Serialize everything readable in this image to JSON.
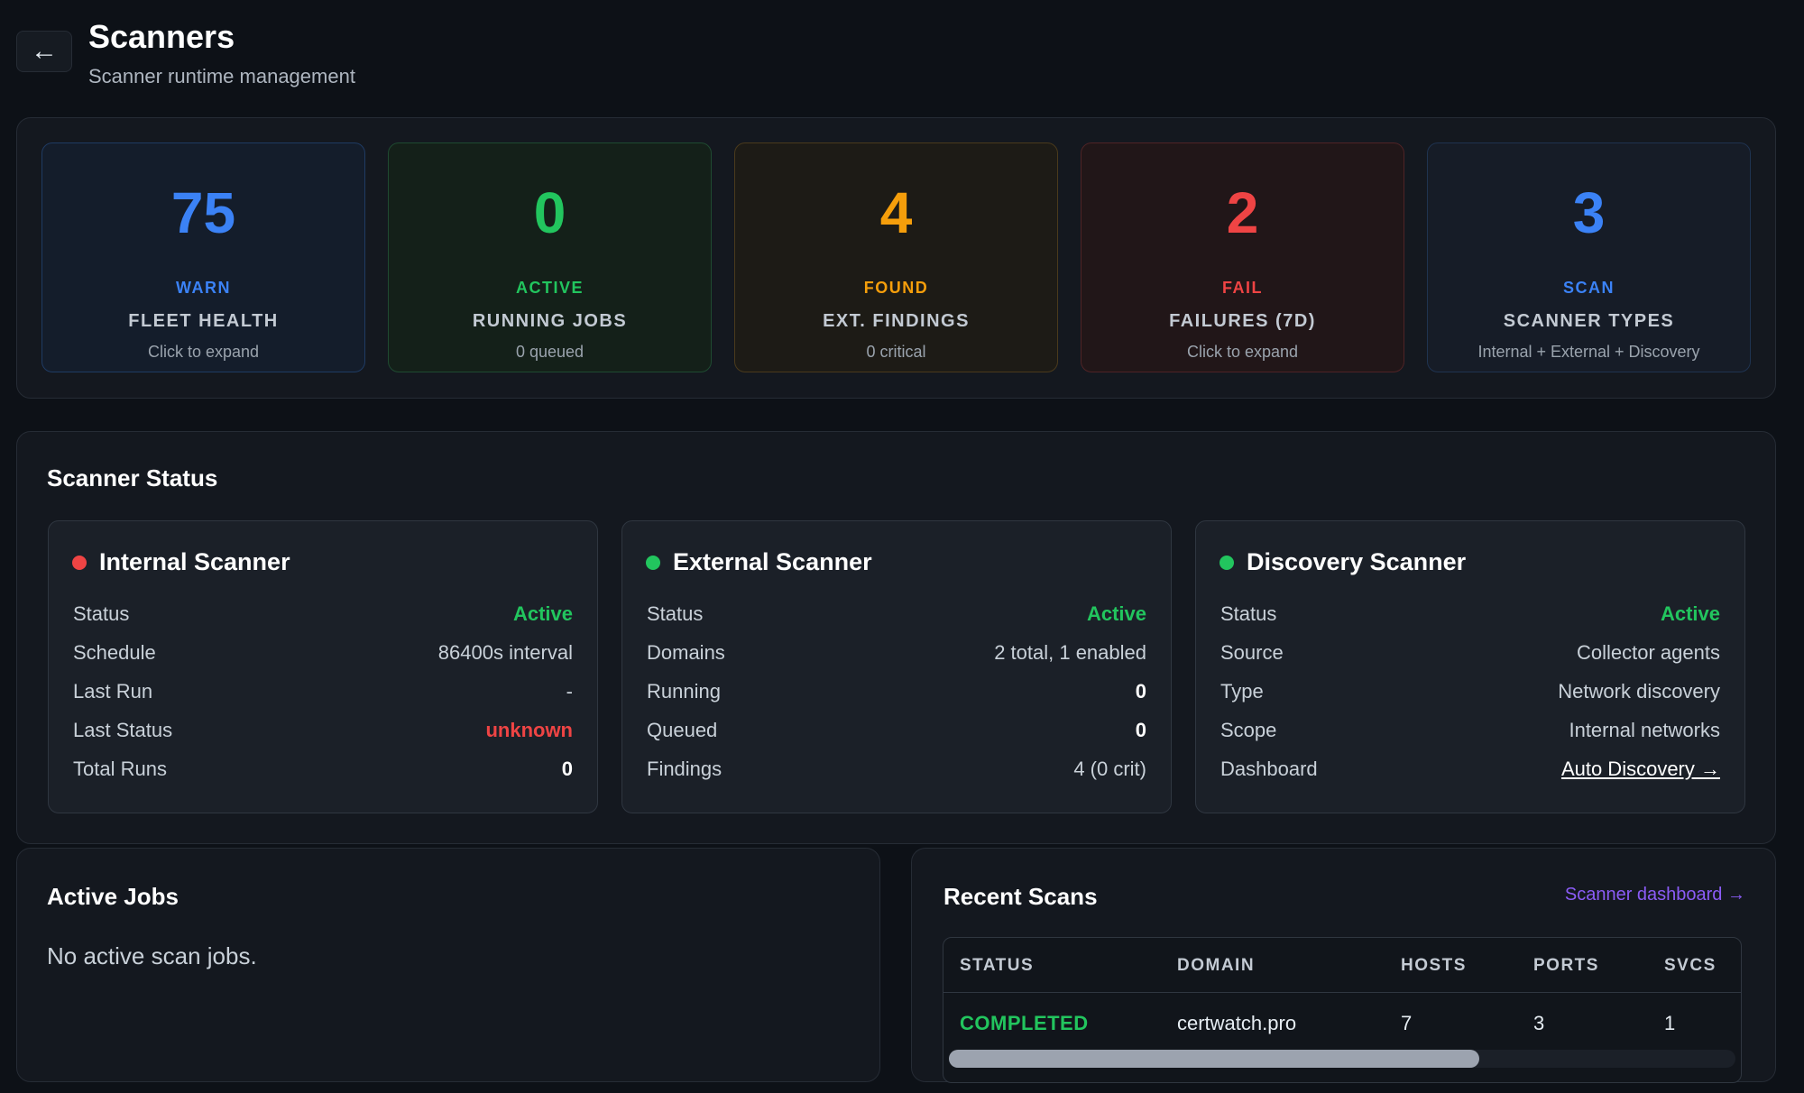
{
  "header": {
    "back_icon": "←",
    "title": "Scanners",
    "subtitle": "Scanner runtime management"
  },
  "stats": [
    {
      "value": "75",
      "tag": "WARN",
      "label": "FLEET HEALTH",
      "sub": "Click to expand",
      "color": "#3b82f6",
      "border": "#1f3b63",
      "bg": "#141d2b"
    },
    {
      "value": "0",
      "tag": "ACTIVE",
      "label": "RUNNING JOBS",
      "sub": "0 queued",
      "color": "#22c55e",
      "border": "#1f4a31",
      "bg": "#142019"
    },
    {
      "value": "4",
      "tag": "FOUND",
      "label": "EXT. FINDINGS",
      "sub": "0 critical",
      "color": "#f59e0b",
      "border": "#4a3a1c",
      "bg": "#1d1b16"
    },
    {
      "value": "2",
      "tag": "FAIL",
      "label": "FAILURES (7D)",
      "sub": "Click to expand",
      "color": "#ef4444",
      "border": "#4f2326",
      "bg": "#211618"
    },
    {
      "value": "3",
      "tag": "SCAN",
      "label": "SCANNER TYPES",
      "sub": "Internal + External + Discovery",
      "color": "#3b82f6",
      "border": "#1f3350",
      "bg": "#161c27"
    }
  ],
  "scanner_status": {
    "title": "Scanner Status",
    "cards": [
      {
        "name": "Internal Scanner",
        "dot_color": "#ef4444",
        "rows": [
          {
            "key": "Status",
            "value": "Active",
            "style": "active"
          },
          {
            "key": "Schedule",
            "value": "86400s interval",
            "style": ""
          },
          {
            "key": "Last Run",
            "value": "-",
            "style": ""
          },
          {
            "key": "Last Status",
            "value": "unknown",
            "style": "bad"
          },
          {
            "key": "Total Runs",
            "value": "0",
            "style": "strong"
          }
        ]
      },
      {
        "name": "External Scanner",
        "dot_color": "#22c55e",
        "rows": [
          {
            "key": "Status",
            "value": "Active",
            "style": "active"
          },
          {
            "key": "Domains",
            "value": "2 total, 1 enabled",
            "style": ""
          },
          {
            "key": "Running",
            "value": "0",
            "style": "strong"
          },
          {
            "key": "Queued",
            "value": "0",
            "style": "strong"
          },
          {
            "key": "Findings",
            "value": "4 (0 crit)",
            "style": ""
          }
        ]
      },
      {
        "name": "Discovery Scanner",
        "dot_color": "#22c55e",
        "rows": [
          {
            "key": "Status",
            "value": "Active",
            "style": "active"
          },
          {
            "key": "Source",
            "value": "Collector agents",
            "style": ""
          },
          {
            "key": "Type",
            "value": "Network discovery",
            "style": ""
          },
          {
            "key": "Scope",
            "value": "Internal networks",
            "style": ""
          },
          {
            "key": "Dashboard",
            "value": "Auto Discovery →",
            "style": "link"
          }
        ]
      }
    ]
  },
  "active_jobs": {
    "title": "Active Jobs",
    "empty_text": "No active scan jobs."
  },
  "recent_scans": {
    "title": "Recent Scans",
    "dashboard_link": "Scanner dashboard →",
    "columns": [
      "STATUS",
      "DOMAIN",
      "HOSTS",
      "PORTS",
      "SVCS"
    ],
    "rows": [
      {
        "status": "COMPLETED",
        "domain": "certwatch.pro",
        "hosts": "7",
        "ports": "3",
        "svcs": "1"
      }
    ]
  }
}
